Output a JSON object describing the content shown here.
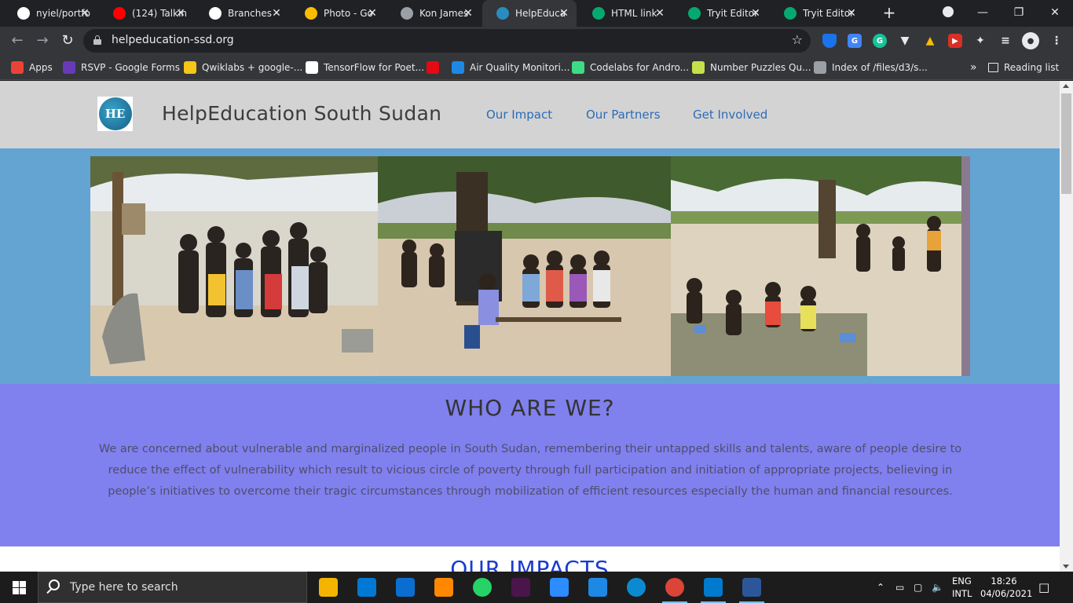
{
  "browser": {
    "tabs": [
      {
        "title": "nyiel/portfo",
        "icon": "github-icon",
        "color": "#ffffff",
        "active": false
      },
      {
        "title": "(124) Talkin",
        "icon": "youtube-icon",
        "color": "#ff0000",
        "active": false
      },
      {
        "title": "Branches ·",
        "icon": "github-icon",
        "color": "#ffffff",
        "active": false
      },
      {
        "title": "Photo - Go",
        "icon": "google-photos-icon",
        "color": "#fbbc04",
        "active": false
      },
      {
        "title": "Kon James",
        "icon": "globe-icon",
        "color": "#9aa0a6",
        "active": false
      },
      {
        "title": "HelpEduca",
        "icon": "helpeducation-icon",
        "color": "#2a8bbf",
        "active": true
      },
      {
        "title": "HTML link",
        "icon": "w3schools-icon",
        "color": "#04aa6d",
        "active": false
      },
      {
        "title": "Tryit Editor",
        "icon": "w3schools-icon",
        "color": "#04aa6d",
        "active": false
      },
      {
        "title": "Tryit Editor",
        "icon": "w3schools-icon",
        "color": "#04aa6d",
        "active": false
      }
    ],
    "url": "helpeducation-ssd.org",
    "bookmarks": [
      {
        "label": "Apps",
        "icon": "apps-grid-icon",
        "color": "#ea4335"
      },
      {
        "label": "RSVP - Google Forms",
        "icon": "google-forms-icon",
        "color": "#673ab7"
      },
      {
        "label": "Qwiklabs + google-...",
        "icon": "qwiklabs-icon",
        "color": "#f5c518"
      },
      {
        "label": "TensorFlow for Poet...",
        "icon": "codelabs-icon",
        "color": "#ffffff"
      },
      {
        "label": "",
        "icon": "netflix-icon",
        "color": "#e50914"
      },
      {
        "label": "Air Quality Monitori...",
        "icon": "hackster-icon",
        "color": "#1e88e5"
      },
      {
        "label": "Codelabs for Andro...",
        "icon": "android-icon",
        "color": "#3ddc84"
      },
      {
        "label": "Number Puzzles Qu...",
        "icon": "puzzle-icon",
        "color": "#c6e04b"
      },
      {
        "label": "Index of /files/d3/s...",
        "icon": "globe-icon",
        "color": "#9aa0a6"
      }
    ],
    "reading_list": "Reading list",
    "overflow": "»"
  },
  "site": {
    "title": "HelpEducation South Sudan",
    "logo_text": "HE",
    "nav": [
      "Our Impact",
      "Our Partners",
      "Get Involved"
    ],
    "who": {
      "heading": "WHO ARE WE?",
      "body": "We are concerned about vulnerable and marginalized people in South Sudan, remembering their untapped skills and talents, aware of people desire to reduce the effect of vulnerability which result to vicious circle of poverty through full participation and initiation of appropriate projects, believing in people’s initiatives to overcome their tragic circumstances through mobilization of efficient resources especially the human and financial resources."
    },
    "impacts_heading": "OUR IMPACTS",
    "colors": {
      "header_bg": "#d3d3d3",
      "hero_bg": "#63a4d2",
      "who_bg": "#8080ee",
      "nav_link": "#2b6cb8",
      "impacts_heading": "#1a3bd0"
    }
  },
  "taskbar": {
    "search_placeholder": "Type here to search",
    "apps": [
      {
        "name": "file-explorer-icon",
        "color": "#f4b400"
      },
      {
        "name": "microsoft-store-icon",
        "color": "#0078d4"
      },
      {
        "name": "mail-icon",
        "color": "#0a6ed1"
      },
      {
        "name": "vlc-icon",
        "color": "#ff8800"
      },
      {
        "name": "whatsapp-icon",
        "color": "#25d366"
      },
      {
        "name": "slack-icon",
        "color": "#4a154b"
      },
      {
        "name": "zoom-icon",
        "color": "#2d8cff"
      },
      {
        "name": "phone-link-icon",
        "color": "#1e88e5"
      },
      {
        "name": "edge-icon",
        "color": "#0c8ad1"
      },
      {
        "name": "chrome-icon",
        "color": "#db4437"
      },
      {
        "name": "vscode-icon",
        "color": "#007acc"
      },
      {
        "name": "word-icon",
        "color": "#2b579a"
      }
    ],
    "lang_top": "ENG",
    "lang_bottom": "INTL",
    "time": "18:26",
    "date": "04/06/2021"
  }
}
